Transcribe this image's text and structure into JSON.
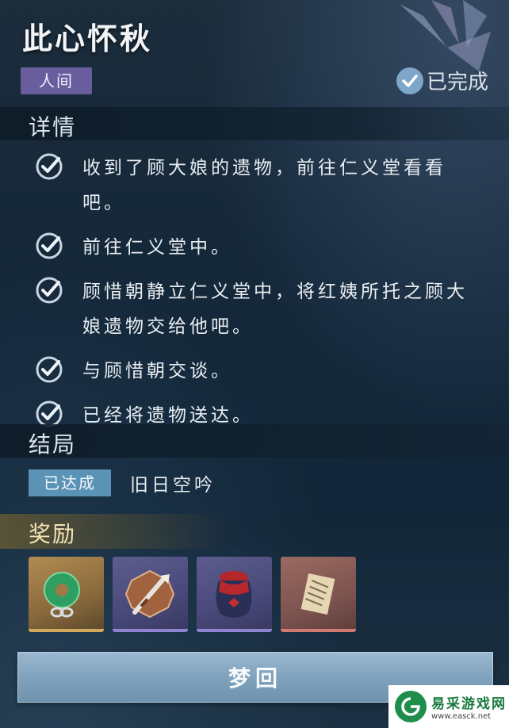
{
  "quest": {
    "title": "此心怀秋",
    "realm_tag": "人间",
    "status": "已完成",
    "details_header": "详情",
    "tasks": [
      "收到了顾大娘的遗物，前往仁义堂看看吧。",
      "前往仁义堂中。",
      "顾惜朝静立仁义堂中，将红姨所托之顾大娘遗物交给他吧。",
      "与顾惜朝交谈。",
      "已经将遗物送达。"
    ],
    "ending_header": "结局",
    "ending_badge": "已达成",
    "ending_name": "旧日空吟",
    "rewards_header": "奖励",
    "rewards": [
      {
        "icon": "jade-pendant-icon",
        "rarity": "gold"
      },
      {
        "icon": "dagger-icon",
        "rarity": "purple"
      },
      {
        "icon": "wine-jar-icon",
        "rarity": "purple"
      },
      {
        "icon": "scroll-letter-icon",
        "rarity": "red"
      }
    ],
    "dream_button": "梦回"
  },
  "watermark": {
    "title": "易采游戏网",
    "url": "www.easck.net"
  },
  "colors": {
    "accent": "#7ea6c9",
    "realm_tag": "#6a5d9e",
    "ending_badge": "#5b93b6",
    "reward_gold": "#d2a85b"
  }
}
